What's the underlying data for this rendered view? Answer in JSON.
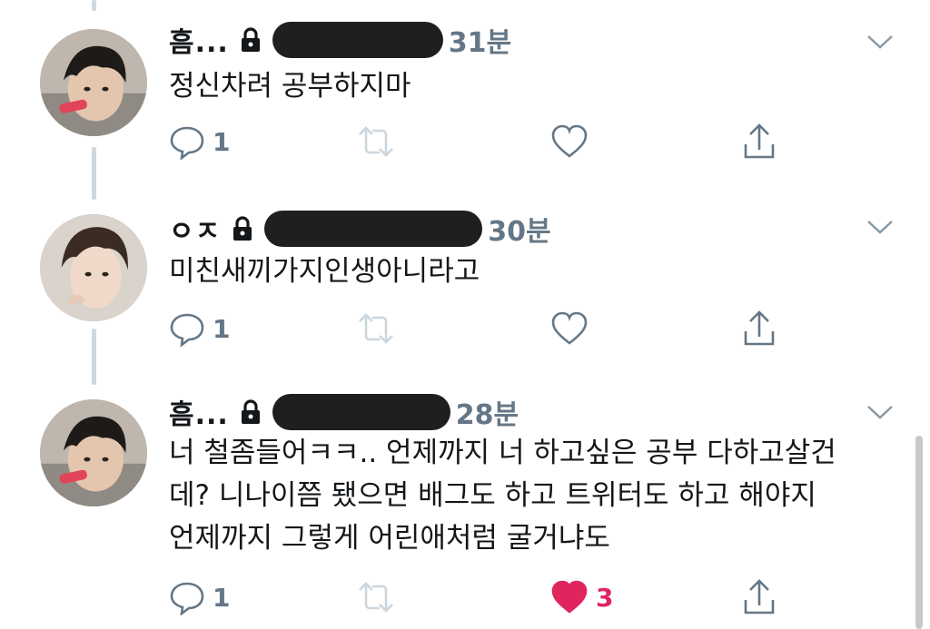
{
  "tweets": [
    {
      "name": "흠...",
      "time": "31분",
      "text": "정신차려 공부하지마",
      "replies": "1",
      "likes": "",
      "liked": false
    },
    {
      "name": "ㅇㅈ",
      "time": "30분",
      "text": "미친새끼가지인생아니라고",
      "replies": "1",
      "likes": "",
      "liked": false
    },
    {
      "name": "흠...",
      "time": "28분",
      "text": "너 철좀들어ㅋㅋ.. 언제까지 너 하고싶은 공부 다하고살건\n데? 니나이쯤 됐으면 배그도 하고 트위터도 하고 해야지\n언제까지 그렇게 어린애처럼 굴거냐도",
      "replies": "1",
      "likes": "3",
      "liked": true
    }
  ],
  "icons": {
    "reply": "reply-icon",
    "retweet": "retweet-icon",
    "like": "heart-icon",
    "share": "share-icon",
    "lock": "lock-icon",
    "more": "chevron-down-icon"
  },
  "colors": {
    "muted": "#657786",
    "like": "#e0245e",
    "thread": "#cfd8df"
  }
}
